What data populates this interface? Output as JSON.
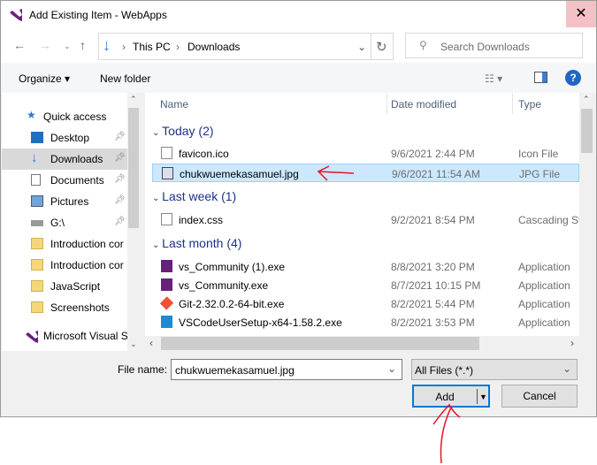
{
  "window": {
    "title": "Add Existing Item - WebApps",
    "close_icon": "close-icon"
  },
  "nav": {
    "breadcrumb": [
      "This PC",
      "Downloads"
    ],
    "search_placeholder": "Search Downloads"
  },
  "toolbar": {
    "organize": "Organize",
    "new_folder": "New folder"
  },
  "sidebar": {
    "items": [
      {
        "label": "Quick access",
        "icon": "star-icon",
        "pinned": false
      },
      {
        "label": "Desktop",
        "icon": "desktop-icon",
        "pinned": true
      },
      {
        "label": "Downloads",
        "icon": "download-icon",
        "pinned": true,
        "selected": true
      },
      {
        "label": "Documents",
        "icon": "documents-icon",
        "pinned": true
      },
      {
        "label": "Pictures",
        "icon": "pictures-icon",
        "pinned": true
      },
      {
        "label": "G:\\",
        "icon": "drive-icon",
        "pinned": true
      },
      {
        "label": "Introduction cor",
        "icon": "folder-icon",
        "pinned": false
      },
      {
        "label": "Introduction cor",
        "icon": "folder-icon",
        "pinned": false
      },
      {
        "label": "JavaScript",
        "icon": "folder-icon",
        "pinned": false
      },
      {
        "label": "Screenshots",
        "icon": "folder-icon",
        "pinned": false
      },
      {
        "label": "Microsoft Visual S",
        "icon": "visual-studio-icon",
        "pinned": false
      }
    ]
  },
  "columns": {
    "name": "Name",
    "date": "Date modified",
    "type": "Type"
  },
  "groups": [
    {
      "label": "Today (2)",
      "files": [
        {
          "name": "favicon.ico",
          "date": "9/6/2021 2:44 PM",
          "type": "Icon File"
        },
        {
          "name": "chukwuemekasamuel.jpg",
          "date": "9/6/2021 11:54 AM",
          "type": "JPG File",
          "selected": true
        }
      ]
    },
    {
      "label": "Last week (1)",
      "files": [
        {
          "name": "index.css",
          "date": "9/2/2021 8:54 PM",
          "type": "Cascading St"
        }
      ]
    },
    {
      "label": "Last month (4)",
      "files": [
        {
          "name": "vs_Community (1).exe",
          "date": "8/8/2021 3:20 PM",
          "type": "Application"
        },
        {
          "name": "vs_Community.exe",
          "date": "8/7/2021 10:15 PM",
          "type": "Application"
        },
        {
          "name": "Git-2.32.0.2-64-bit.exe",
          "date": "8/2/2021 5:44 PM",
          "type": "Application"
        },
        {
          "name": "VSCodeUserSetup-x64-1.58.2.exe",
          "date": "8/2/2021 3:53 PM",
          "type": "Application"
        }
      ]
    }
  ],
  "footer": {
    "file_name_label": "File name:",
    "file_name_value": "chukwuemekasamuel.jpg",
    "file_type": "All Files (*.*)",
    "add": "Add",
    "cancel": "Cancel"
  },
  "colors": {
    "accent": "#0078d7",
    "selection": "#cce8ff",
    "annotation": "#e81123"
  }
}
